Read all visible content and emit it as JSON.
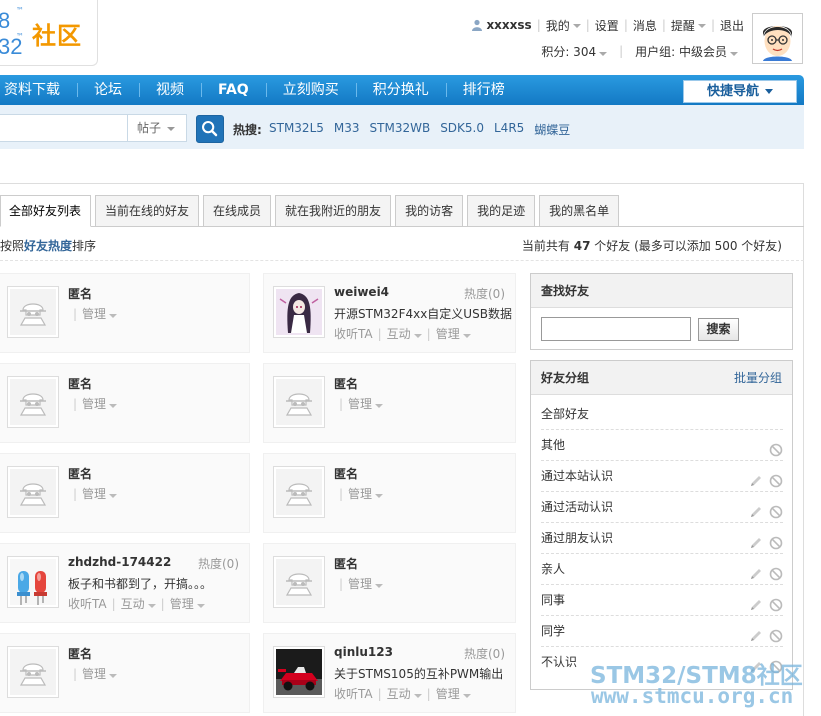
{
  "logo": {
    "digits_top": "8",
    "digits_bottom": "32",
    "tm": "™",
    "text": "社区"
  },
  "user": {
    "username": "xxxxss",
    "my": "我的",
    "settings": "设置",
    "messages": "消息",
    "reminders": "提醒",
    "logout": "退出",
    "points": "积分: 304",
    "usergroup": "用户组: 中级会员"
  },
  "nav": {
    "items": [
      "资料下载",
      "论坛",
      "视频",
      "FAQ",
      "立刻购买",
      "积分换礼",
      "排行榜"
    ],
    "quick_nav": "快捷导航"
  },
  "search": {
    "type": "帖子",
    "hot_label": "热搜:",
    "hot": [
      "STM32L5",
      "M33",
      "STM32WB",
      "SDK5.0",
      "L4R5",
      "蝴蝶豆"
    ]
  },
  "tabs": [
    "全部好友列表",
    "当前在线的好友",
    "在线成员",
    "就在我附近的朋友",
    "我的访客",
    "我的足迹",
    "我的黑名单"
  ],
  "sort": {
    "prefix": "按照",
    "key": "好友热度",
    "suffix": "排序"
  },
  "count": {
    "prefix": "当前共有",
    "num": "47",
    "suffix": "个好友 (最多可以添加 500 个好友)"
  },
  "actions": {
    "listen": "收听TA",
    "interact": "互动",
    "manage": "管理"
  },
  "friends": [
    {
      "name": "匿名",
      "heat": "",
      "note": "",
      "full": false
    },
    {
      "name": "weiwei4",
      "heat": "热度(0)",
      "note": "开源STM32F4xx自定义USB数据",
      "full": true
    },
    {
      "name": "匿名",
      "heat": "",
      "note": "",
      "full": false
    },
    {
      "name": "匿名",
      "heat": "",
      "note": "",
      "full": false
    },
    {
      "name": "匿名",
      "heat": "",
      "note": "",
      "full": false
    },
    {
      "name": "匿名",
      "heat": "",
      "note": "",
      "full": false
    },
    {
      "name": "zhdzhd-174422",
      "heat": "热度(0)",
      "note": "板子和书都到了，开搞。。。",
      "full": true
    },
    {
      "name": "匿名",
      "heat": "",
      "note": "",
      "full": false
    },
    {
      "name": "匿名",
      "heat": "",
      "note": "",
      "full": false
    },
    {
      "name": "qinlu123",
      "heat": "热度(0)",
      "note": "关于STMS105的互补PWM输出",
      "full": true
    }
  ],
  "find": {
    "title": "查找好友",
    "button": "搜索"
  },
  "groups": {
    "title": "好友分组",
    "batch": "批量分组",
    "items": [
      "全部好友",
      "其他",
      "通过本站认识",
      "通过活动认识",
      "通过朋友认识",
      "亲人",
      "同事",
      "同学",
      "不认识"
    ]
  },
  "watermark": {
    "line1": "STM32/STM8社区",
    "line2": "www.stmcu.org.cn"
  },
  "colors": {
    "nav_blue": "#1f8ad6",
    "link": "#336699",
    "logo_orange": "#f39800"
  }
}
